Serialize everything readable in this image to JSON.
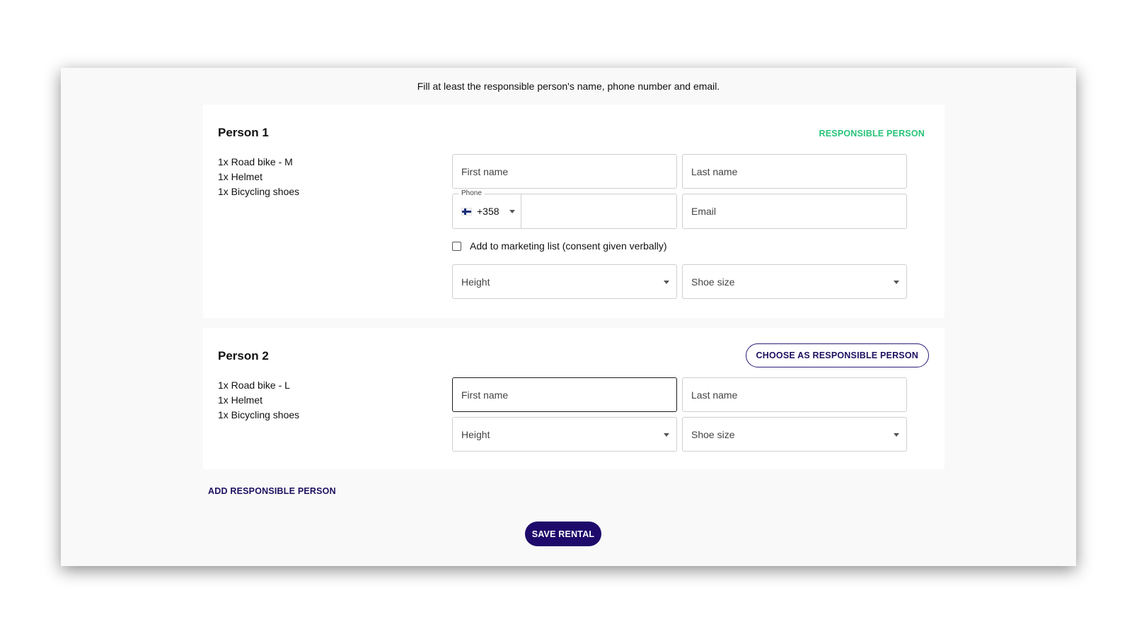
{
  "instruction": "Fill at least the responsible person's name, phone number and email.",
  "people": [
    {
      "title": "Person 1",
      "badge": "RESPONSIBLE PERSON",
      "items": [
        "1x Road bike - M",
        "1x Helmet",
        "1x Bicycling shoes"
      ],
      "first_name_placeholder": "First name",
      "last_name_placeholder": "Last name",
      "phone_label": "Phone",
      "phone_prefix": "+358",
      "phone_flag": "finland-flag-icon",
      "email_placeholder": "Email",
      "marketing_label": "Add to marketing list (consent given verbally)",
      "height_placeholder": "Height",
      "shoe_size_placeholder": "Shoe size"
    },
    {
      "title": "Person 2",
      "choose_button": "CHOOSE AS RESPONSIBLE PERSON",
      "items": [
        "1x Road bike - L",
        "1x Helmet",
        "1x Bicycling shoes"
      ],
      "first_name_placeholder": "First name",
      "last_name_placeholder": "Last name",
      "height_placeholder": "Height",
      "shoe_size_placeholder": "Shoe size"
    }
  ],
  "add_responsible_label": "ADD RESPONSIBLE PERSON",
  "save_button": "SAVE RENTAL",
  "colors": {
    "accent_green": "#27c47a",
    "brand_navy": "#1e0a6b"
  }
}
